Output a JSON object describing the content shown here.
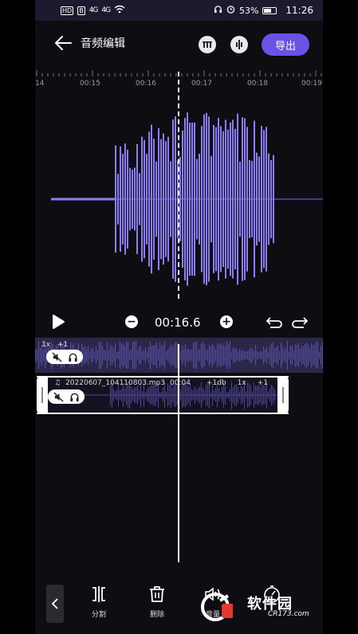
{
  "status_bar": {
    "hd_badge": "HD",
    "extra_badge": "B",
    "signal1": "4G",
    "signal2": "4G",
    "battery": "53%",
    "time": "11:26"
  },
  "header": {
    "title": "音频编辑",
    "export_label": "导出"
  },
  "ruler": {
    "labels": [
      "14",
      "00:15",
      "00:16",
      "00:17",
      "00:18",
      "00:19"
    ]
  },
  "controls": {
    "minus": "−",
    "plus": "+",
    "time": "00:16.6"
  },
  "track1": {
    "speed": "1x",
    "pitch": "+1"
  },
  "track2": {
    "filename": "20220607_104110803.mp3",
    "duration": "00:04",
    "volume": "+1db",
    "speed": "1x",
    "pitch": "+1"
  },
  "toolbar": {
    "items": [
      {
        "label": "分割",
        "icon": "split-icon"
      },
      {
        "label": "删除",
        "icon": "trash-icon"
      },
      {
        "label": "音量",
        "icon": "volume-icon"
      },
      {
        "label": "",
        "icon": "speed-icon"
      }
    ]
  },
  "watermark": {
    "brand": "软件园",
    "site": "CR173.com"
  },
  "colors": {
    "accent": "#6a52e6",
    "wave": "#8b7df2",
    "background": "#0e0e12"
  }
}
